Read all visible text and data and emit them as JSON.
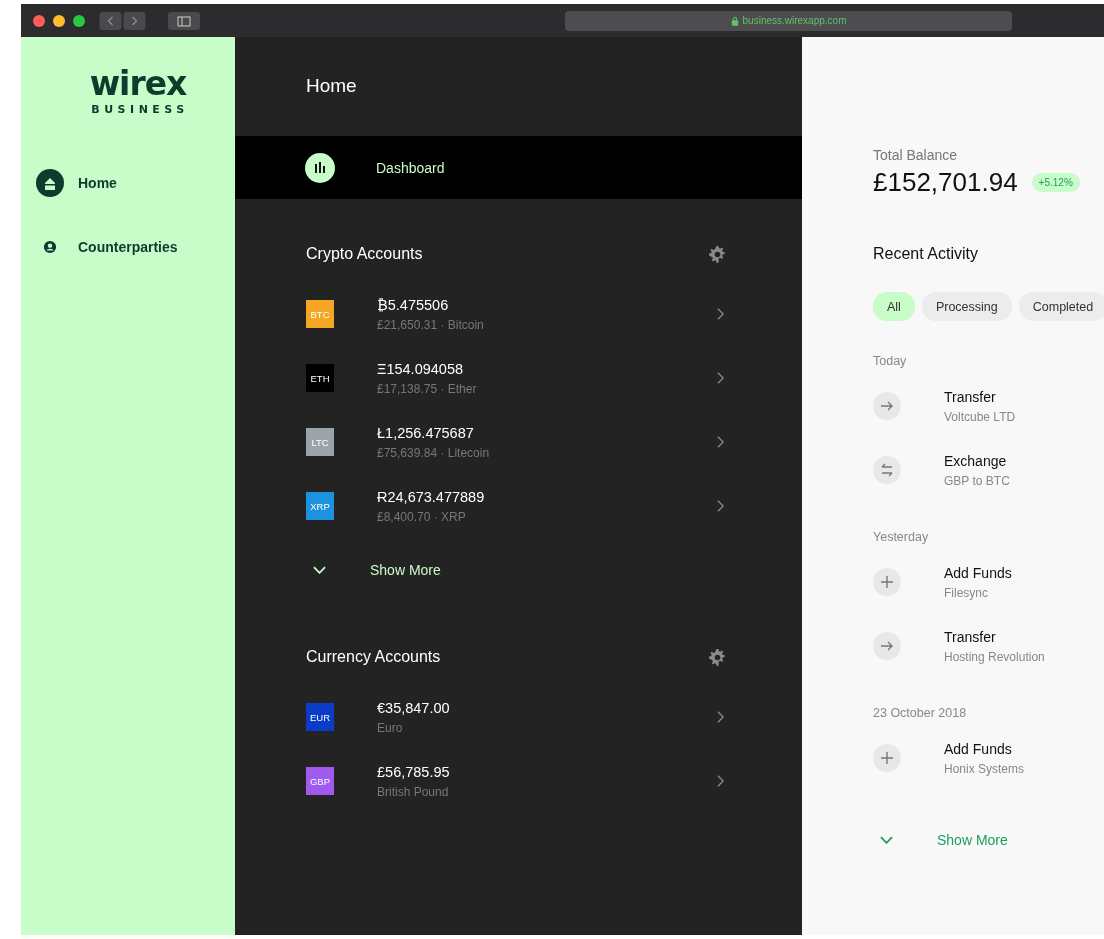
{
  "browser": {
    "url": "business.wirexapp.com"
  },
  "logo": {
    "wordmark": "wirex",
    "subtitle": "BUSINESS"
  },
  "sidebar": {
    "items": [
      {
        "label": "Home",
        "kind": "home",
        "selected": true
      },
      {
        "label": "Counterparties",
        "kind": "person",
        "selected": false
      }
    ]
  },
  "main": {
    "title": "Home",
    "dashboard": {
      "label": "Dashboard",
      "selected": true
    },
    "sections": [
      {
        "title": "Crypto Accounts",
        "accounts": [
          {
            "code": "BTC",
            "color": "#f5a623",
            "amount": "₿5.475506",
            "detail": "£21,650.31 · Bitcoin"
          },
          {
            "code": "ETH",
            "color": "#000000",
            "amount": "Ξ154.094058",
            "detail": "£17,138.75 · Ether"
          },
          {
            "code": "LTC",
            "color": "#9aa5a9",
            "amount": "Ł1,256.475687",
            "detail": "£75,639.84 · Litecoin"
          },
          {
            "code": "XRP",
            "color": "#1d93e0",
            "amount": "Ɍ24,673.477889",
            "detail": "£8,400.70 · XRP"
          }
        ],
        "show_more": "Show More"
      },
      {
        "title": "Currency Accounts",
        "accounts": [
          {
            "code": "EUR",
            "color": "#0a3cc8",
            "amount": "€35,847.00",
            "detail": "Euro"
          },
          {
            "code": "GBP",
            "color": "#a05af0",
            "amount": "£56,785.95",
            "detail": "British Pound"
          }
        ]
      }
    ]
  },
  "balance": {
    "label": "Total Balance",
    "amount": "£152,701.94",
    "change": "+5.12%"
  },
  "activity": {
    "title": "Recent Activity",
    "filters": [
      {
        "label": "All",
        "selected": true
      },
      {
        "label": "Processing",
        "selected": false
      },
      {
        "label": "Completed",
        "selected": false
      }
    ],
    "groups": [
      {
        "date": "Today",
        "items": [
          {
            "kind": "transfer",
            "title": "Transfer",
            "party": "Voltcube LTD"
          },
          {
            "kind": "exchange",
            "title": "Exchange",
            "party": "GBP to BTC"
          }
        ]
      },
      {
        "date": "Yesterday",
        "items": [
          {
            "kind": "add",
            "title": "Add Funds",
            "party": "Filesync"
          },
          {
            "kind": "transfer",
            "title": "Transfer",
            "party": "Hosting Revolution"
          }
        ]
      },
      {
        "date": "23 October 2018",
        "items": [
          {
            "kind": "add",
            "title": "Add Funds",
            "party": "Honix Systems"
          }
        ]
      }
    ],
    "show_more": "Show More"
  }
}
